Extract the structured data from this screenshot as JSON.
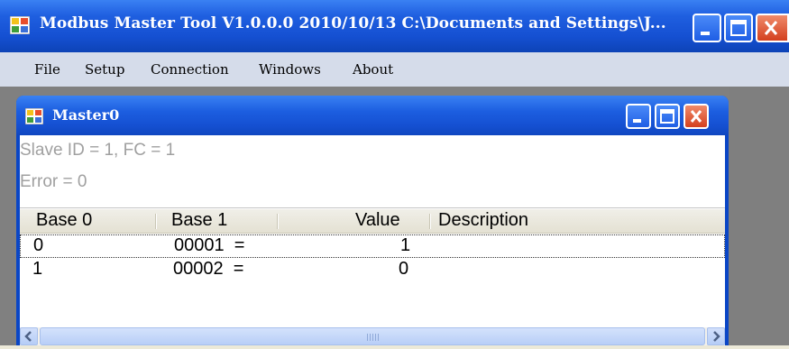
{
  "app": {
    "title": "Modbus Master Tool V1.0.0.0  2010/10/13  C:\\Documents and Settings\\J..."
  },
  "menu": {
    "items": [
      {
        "label": "File"
      },
      {
        "label": "Setup"
      },
      {
        "label": "Connection"
      },
      {
        "label": "Windows"
      },
      {
        "label": "About"
      }
    ]
  },
  "child_window": {
    "title": "Master0",
    "status_line_1": "Slave ID = 1, FC = 1",
    "status_line_2": "Error = 0"
  },
  "listview": {
    "columns": [
      "Base 0",
      "Base 1",
      "Value",
      "Description"
    ],
    "rows": [
      {
        "base0": "0",
        "base1": "00001  =",
        "value": "1",
        "description": ""
      },
      {
        "base0": "1",
        "base1": "00002  =",
        "value": "0",
        "description": ""
      }
    ]
  },
  "colors": {
    "title_bar": "#1550d2",
    "menu_bar": "#d5dcea",
    "close_button": "#d4401e",
    "mdi_background": "#808080"
  }
}
